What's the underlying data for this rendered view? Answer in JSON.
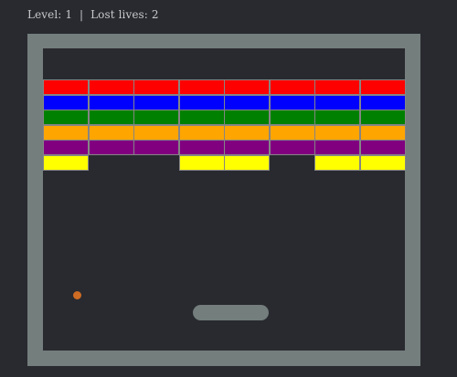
{
  "status": {
    "level_label": "Level: 1",
    "separator": "|",
    "lives_label": "Lost lives: 2"
  },
  "colors": {
    "background": "#292a2f",
    "wall": "#737e7d",
    "ball": "#cf6c23",
    "paddle": "#737e7d"
  },
  "bricks": {
    "columns": 8,
    "rows": [
      {
        "color": "#ff0000",
        "present": [
          1,
          1,
          1,
          1,
          1,
          1,
          1,
          1
        ]
      },
      {
        "color": "#0000ff",
        "present": [
          1,
          1,
          1,
          1,
          1,
          1,
          1,
          1
        ]
      },
      {
        "color": "#008000",
        "present": [
          1,
          1,
          1,
          1,
          1,
          1,
          1,
          1
        ]
      },
      {
        "color": "#ffa500",
        "present": [
          1,
          1,
          1,
          1,
          1,
          1,
          1,
          1
        ]
      },
      {
        "color": "#800080",
        "present": [
          1,
          1,
          1,
          1,
          1,
          1,
          1,
          1
        ]
      },
      {
        "color": "#ffff00",
        "present": [
          1,
          0,
          0,
          1,
          1,
          0,
          1,
          1
        ]
      }
    ]
  }
}
